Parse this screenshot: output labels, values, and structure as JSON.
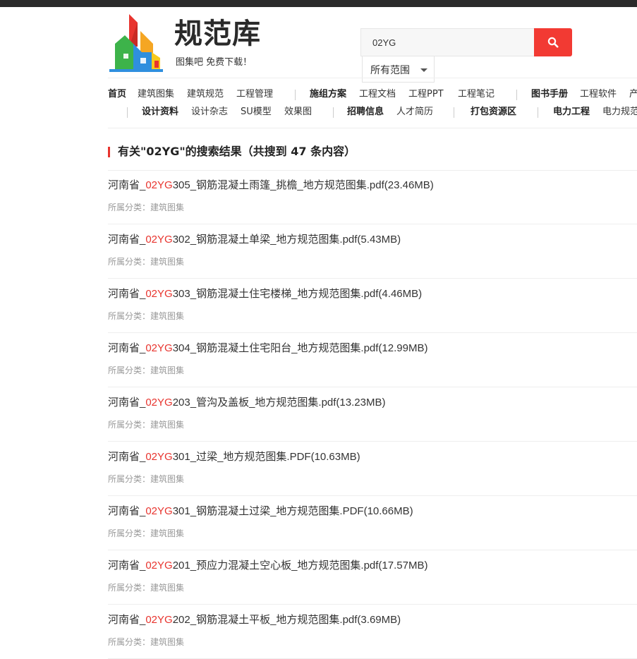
{
  "brand": {
    "title": "规范库",
    "slogan": "图集吧  免费下载！",
    "colors": {
      "red": "#e8342e",
      "orange": "#f5a623",
      "blue": "#2f8fde",
      "green": "#3db34a",
      "yellow": "#f7c91c"
    }
  },
  "search": {
    "value": "02YG",
    "button_icon": "search-icon",
    "scope_label": "所有范围",
    "button_color": "#f23a33"
  },
  "nav": {
    "row1": [
      {
        "label": "首页",
        "bold": true
      },
      {
        "label": "建筑图集"
      },
      {
        "label": "建筑规范"
      },
      {
        "label": "工程管理"
      },
      {
        "label": "施组方案",
        "bold": true
      },
      {
        "label": "工程文档"
      },
      {
        "label": "工程PPT"
      },
      {
        "label": "工程笔记"
      },
      {
        "label": "图书手册",
        "bold": true
      },
      {
        "label": "工程软件"
      },
      {
        "label": "产"
      }
    ],
    "row2": [
      {
        "label": "设计资料",
        "bold": true
      },
      {
        "label": "设计杂志"
      },
      {
        "label": "SU模型"
      },
      {
        "label": "效果图"
      },
      {
        "label": "招聘信息",
        "bold": true
      },
      {
        "label": "人才简历"
      },
      {
        "label": "打包资源区",
        "bold": true
      },
      {
        "label": "电力工程",
        "bold": true
      },
      {
        "label": "电力规范"
      }
    ]
  },
  "results_header": {
    "prefix": "有关\"",
    "keyword": "02YG",
    "suffix": "\"的搜索结果（共搜到 47 条内容）",
    "full": "有关\"02YG\"的搜索结果（共搜到 47 条内容）"
  },
  "category_label": "所属分类：",
  "results": [
    {
      "pre": "河南省_",
      "hl": "02YG",
      "post": "305_钢筋混凝土雨篷_挑檐_地方规范图集.pdf(23.46MB)",
      "category": "建筑图集"
    },
    {
      "pre": "河南省_",
      "hl": "02YG",
      "post": "302_钢筋混凝土单梁_地方规范图集.pdf(5.43MB)",
      "category": "建筑图集"
    },
    {
      "pre": "河南省_",
      "hl": "02YG",
      "post": "303_钢筋混凝土住宅楼梯_地方规范图集.pdf(4.46MB)",
      "category": "建筑图集"
    },
    {
      "pre": "河南省_",
      "hl": "02YG",
      "post": "304_钢筋混凝土住宅阳台_地方规范图集.pdf(12.99MB)",
      "category": "建筑图集"
    },
    {
      "pre": "河南省_",
      "hl": "02YG",
      "post": "203_管沟及盖板_地方规范图集.pdf(13.23MB)",
      "category": "建筑图集"
    },
    {
      "pre": "河南省_",
      "hl": "02YG",
      "post": "301_过梁_地方规范图集.PDF(10.63MB)",
      "category": "建筑图集"
    },
    {
      "pre": "河南省_",
      "hl": "02YG",
      "post": "301_钢筋混凝土过梁_地方规范图集.PDF(10.66MB)",
      "category": "建筑图集"
    },
    {
      "pre": "河南省_",
      "hl": "02YG",
      "post": "201_预应力混凝土空心板_地方规范图集.pdf(17.57MB)",
      "category": "建筑图集"
    },
    {
      "pre": "河南省_",
      "hl": "02YG",
      "post": "202_钢筋混凝土平板_地方规范图集.pdf(3.69MB)",
      "category": "建筑图集"
    }
  ]
}
